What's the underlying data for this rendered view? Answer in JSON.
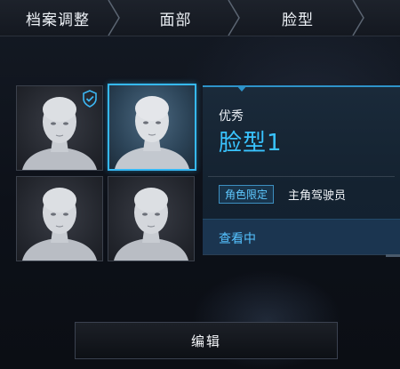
{
  "breadcrumb": {
    "items": [
      "档案调整",
      "面部",
      "脸型"
    ]
  },
  "faces": {
    "cards": [
      {
        "selected": false,
        "equipped": true
      },
      {
        "selected": true,
        "equipped": false
      },
      {
        "selected": false,
        "equipped": false
      },
      {
        "selected": false,
        "equipped": false
      }
    ]
  },
  "detail": {
    "rarity": "优秀",
    "name": "脸型1",
    "role_tag": "角色限定",
    "role_value": "主角驾驶员",
    "status": "查看中"
  },
  "edit_button": {
    "label": "编辑"
  },
  "colors": {
    "accent": "#36b9f5",
    "name_text": "#39c3ff",
    "panel_bg": "#142230"
  }
}
